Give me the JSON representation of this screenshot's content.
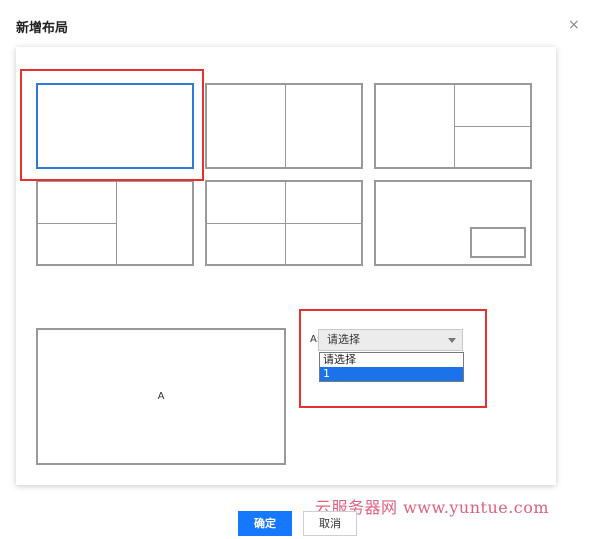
{
  "dialog": {
    "title": "新增布局",
    "close_symbol": "×"
  },
  "layouts": [
    {
      "name": "single",
      "selected": true
    },
    {
      "name": "two-columns"
    },
    {
      "name": "left-one-right-two"
    },
    {
      "name": "left-two-right-one"
    },
    {
      "name": "grid-2x2"
    },
    {
      "name": "picture-in-picture"
    }
  ],
  "preview": {
    "region_label": "A"
  },
  "region_select": {
    "label": "A:",
    "selected": "请选择",
    "options": [
      "请选择",
      "1"
    ],
    "highlighted_option": "1"
  },
  "buttons": {
    "confirm": "确定",
    "cancel": "取消"
  },
  "watermark": "云服务器网 www.yuntue.com",
  "colors": {
    "primary": "#1677ff",
    "selected_border": "#2e7ad6",
    "annotation_red": "#e8312f",
    "watermark": "#e0607e"
  }
}
